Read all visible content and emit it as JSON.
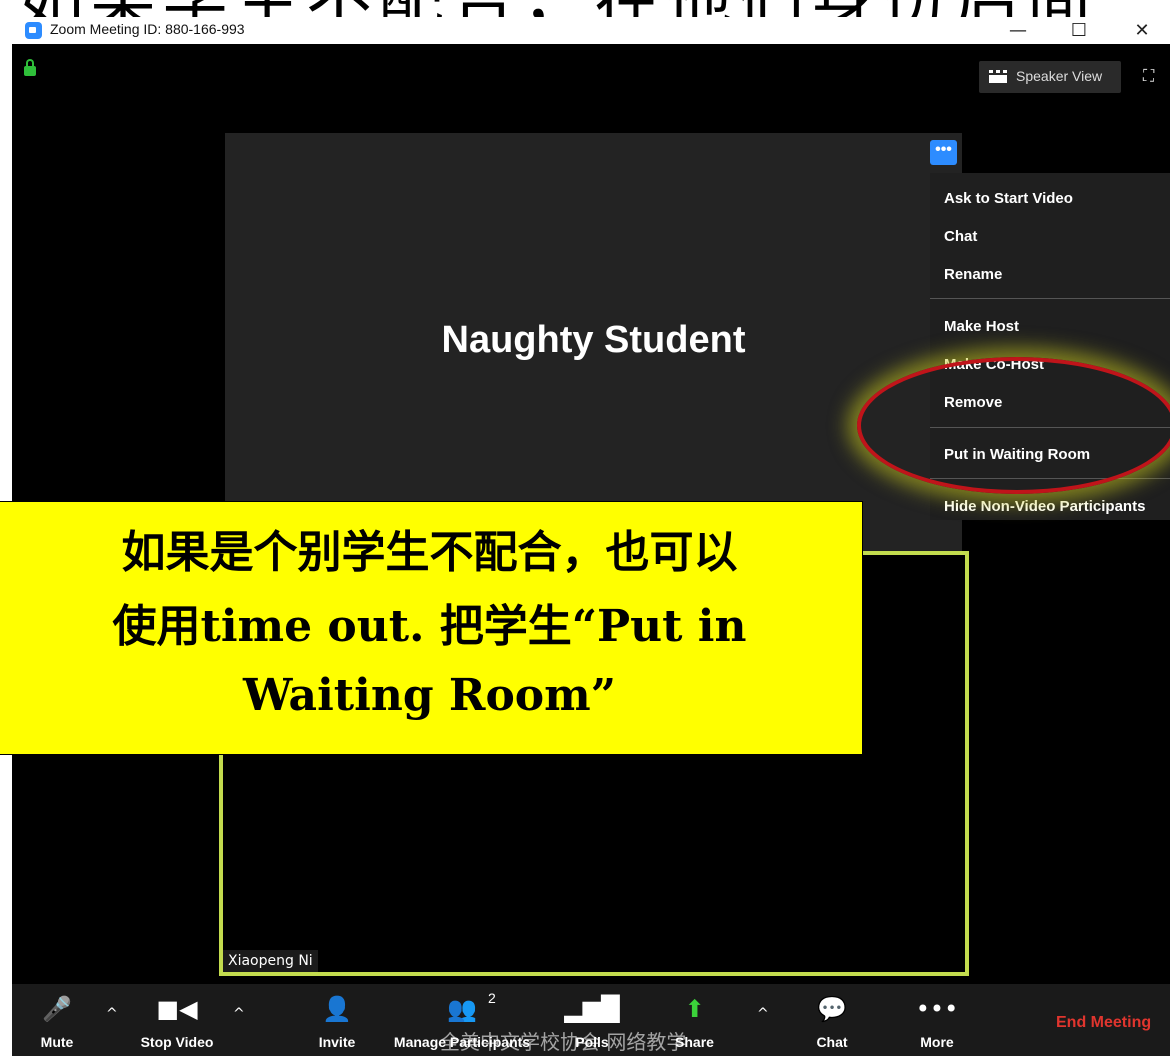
{
  "overlay_top_text": "如果学生不配合，在他们身份后面",
  "window": {
    "title": "Zoom Meeting ID: 880-166-993",
    "minimize": "—",
    "maximize": "☐",
    "close": "✕"
  },
  "view": {
    "speaker_view_label": "Speaker View",
    "fullscreen_icon": "⛶"
  },
  "participant": {
    "name": "Naughty Student",
    "more_button": "•••"
  },
  "context_menu": {
    "items": [
      "Ask to Start Video",
      "Chat",
      "Rename",
      "Make Host",
      "Make Co-Host",
      "Remove",
      "Put in Waiting Room",
      "Hide Non-Video Participants"
    ]
  },
  "self_view": {
    "name": "Xiaopeng Ni"
  },
  "callout": {
    "line1": "如果是个别学生不配合，也可以",
    "line2": "使用time out. 把学生“Put in",
    "line3": "Waiting Room”"
  },
  "toolbar": {
    "mute": "Mute",
    "stop_video": "Stop Video",
    "invite": "Invite",
    "manage_participants": "Manage Participants",
    "participant_count": "2",
    "polls": "Polls",
    "share": "Share",
    "chat": "Chat",
    "more": "More",
    "end_meeting": "End Meeting"
  },
  "watermark": "全美中文学校协会  网络教学",
  "colors": {
    "accent": "#2d8cff",
    "end_meeting": "#e0352e",
    "share_green": "#3bd23a",
    "callout_yellow": "#ffff00",
    "highlight_red": "#c0141a"
  }
}
